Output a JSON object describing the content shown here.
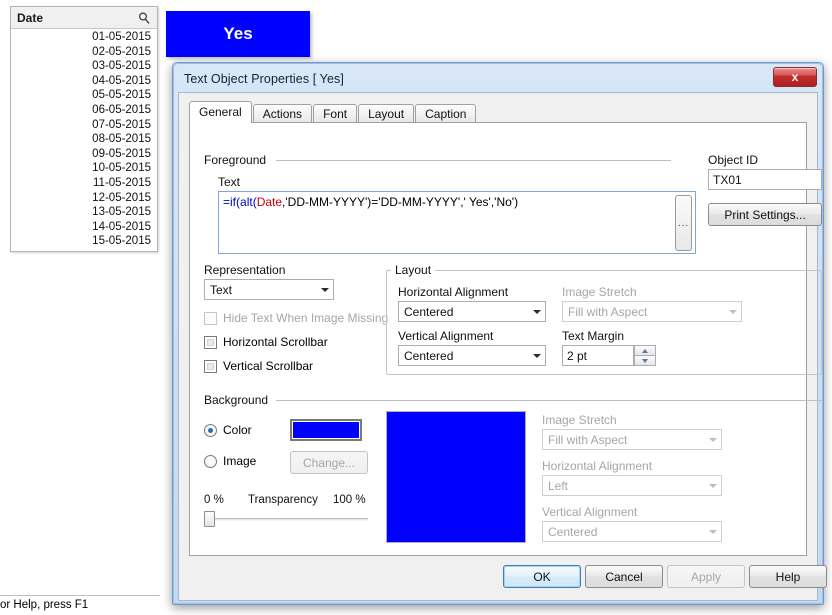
{
  "listbox": {
    "title": "Date",
    "search_icon": "search-icon",
    "items": [
      "01-05-2015",
      "02-05-2015",
      "03-05-2015",
      "04-05-2015",
      "05-05-2015",
      "06-05-2015",
      "07-05-2015",
      "08-05-2015",
      "09-05-2015",
      "10-05-2015",
      "11-05-2015",
      "12-05-2015",
      "13-05-2015",
      "14-05-2015",
      "15-05-2015"
    ]
  },
  "text_object": {
    "value": "Yes",
    "background_color": "#0000ff",
    "text_color": "#ffffff"
  },
  "status_bar": {
    "text": "or Help, press F1"
  },
  "dialog": {
    "title": "Text Object Properties [ Yes]",
    "close_label": "x",
    "tabs": [
      {
        "label": "General",
        "active": true
      },
      {
        "label": "Actions",
        "active": false
      },
      {
        "label": "Font",
        "active": false
      },
      {
        "label": "Layout",
        "active": false
      },
      {
        "label": "Caption",
        "active": false
      }
    ],
    "foreground": {
      "group_label": "Foreground",
      "text_label": "Text",
      "formula": {
        "full": "=if(alt(Date,'DD-MM-YYYY')='DD-MM-YYYY',' Yes','No')",
        "t1": "=if(",
        "t2": "alt(",
        "t3": "Date",
        "t4": ",'DD-MM-YYYY')='DD-MM-YYYY',' Yes','No')"
      },
      "expand_button": "..."
    },
    "object_id": {
      "label": "Object ID",
      "value": "TX01"
    },
    "print_settings_label": "Print Settings...",
    "representation": {
      "label": "Representation",
      "value": "Text"
    },
    "checkboxes": [
      {
        "label": "Hide Text When Image Missing",
        "checked": false,
        "disabled": true
      },
      {
        "label": "Horizontal Scrollbar",
        "checked": false,
        "disabled": false
      },
      {
        "label": "Vertical Scrollbar",
        "checked": false,
        "disabled": false
      }
    ],
    "layout": {
      "group_label": "Layout",
      "horizontal_alignment_label": "Horizontal Alignment",
      "horizontal_alignment_value": "Centered",
      "vertical_alignment_label": "Vertical Alignment",
      "vertical_alignment_value": "Centered",
      "image_stretch_label": "Image Stretch",
      "image_stretch_value": "Fill with Aspect",
      "text_margin_label": "Text Margin",
      "text_margin_value": "2 pt"
    },
    "background": {
      "group_label": "Background",
      "color_radio_label": "Color",
      "image_radio_label": "Image",
      "selected": "Color",
      "color_value": "#0000ff",
      "change_button_label": "Change...",
      "transparency_label": "Transparency",
      "transparency_min": "0 %",
      "transparency_max": "100 %",
      "transparency_value": 0,
      "preview_color": "#0000ff",
      "image_stretch_label": "Image Stretch",
      "image_stretch_value": "Fill with Aspect",
      "horizontal_alignment_label": "Horizontal Alignment",
      "horizontal_alignment_value": "Left",
      "vertical_alignment_label": "Vertical Alignment",
      "vertical_alignment_value": "Centered"
    },
    "buttons": [
      {
        "label": "OK",
        "state": "focus"
      },
      {
        "label": "Cancel",
        "state": "normal"
      },
      {
        "label": "Apply",
        "state": "disabled"
      },
      {
        "label": "Help",
        "state": "normal"
      }
    ]
  }
}
